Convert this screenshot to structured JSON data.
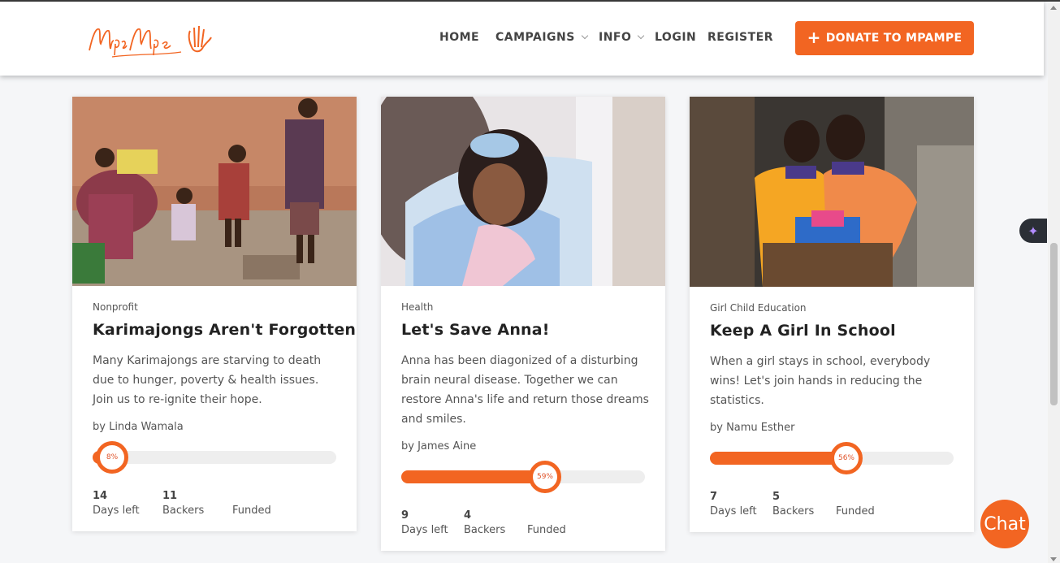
{
  "brand": {
    "logo_text": "MpaMpe"
  },
  "nav": [
    {
      "label": "HOME",
      "has_dropdown": false
    },
    {
      "label": "CAMPAIGNS",
      "has_dropdown": true
    },
    {
      "label": "INFO",
      "has_dropdown": true
    },
    {
      "label": "LOGIN",
      "has_dropdown": false
    },
    {
      "label": "REGISTER",
      "has_dropdown": false
    }
  ],
  "donate_button": {
    "label": "DONATE TO MPAMPE",
    "icon": "plus-icon"
  },
  "colors": {
    "accent": "#f26522",
    "background": "#f5f6f8"
  },
  "campaigns": [
    {
      "category": "Nonprofit",
      "title": "Karimajongs Aren't Forgotten",
      "description": "Many Karimajongs are starving to death due to hunger, poverty & health issues. Join us to re-ignite their hope.",
      "author": "by Linda Wamala",
      "progress": 0.08,
      "progress_label": "8%",
      "days_left": "14",
      "days_left_label": "Days left",
      "backers": "11",
      "backers_label": "Backers",
      "funded": "",
      "funded_label": "Funded"
    },
    {
      "category": "Health",
      "title": "Let's Save Anna!",
      "description": "Anna has been diagonized of a disturbing brain neural disease. Together we can restore Anna's life and return those dreams and smiles.",
      "author": "by James Aine",
      "progress": 0.59,
      "progress_label": "59%",
      "days_left": "9",
      "days_left_label": "Days left",
      "backers": "4",
      "backers_label": "Backers",
      "funded": "",
      "funded_label": "Funded"
    },
    {
      "category": "Girl Child Education",
      "title": "Keep A Girl In School",
      "description": "When a girl stays in school, everybody wins! Let's join hands in reducing the statistics.",
      "author": "by Namu Esther",
      "progress": 0.56,
      "progress_label": "56%",
      "days_left": "7",
      "days_left_label": "Days left",
      "backers": "5",
      "backers_label": "Backers",
      "funded": "",
      "funded_label": "Funded"
    }
  ],
  "chat": {
    "label": "Chat"
  },
  "ai_assistant": {
    "icon": "sparkle-icon"
  }
}
